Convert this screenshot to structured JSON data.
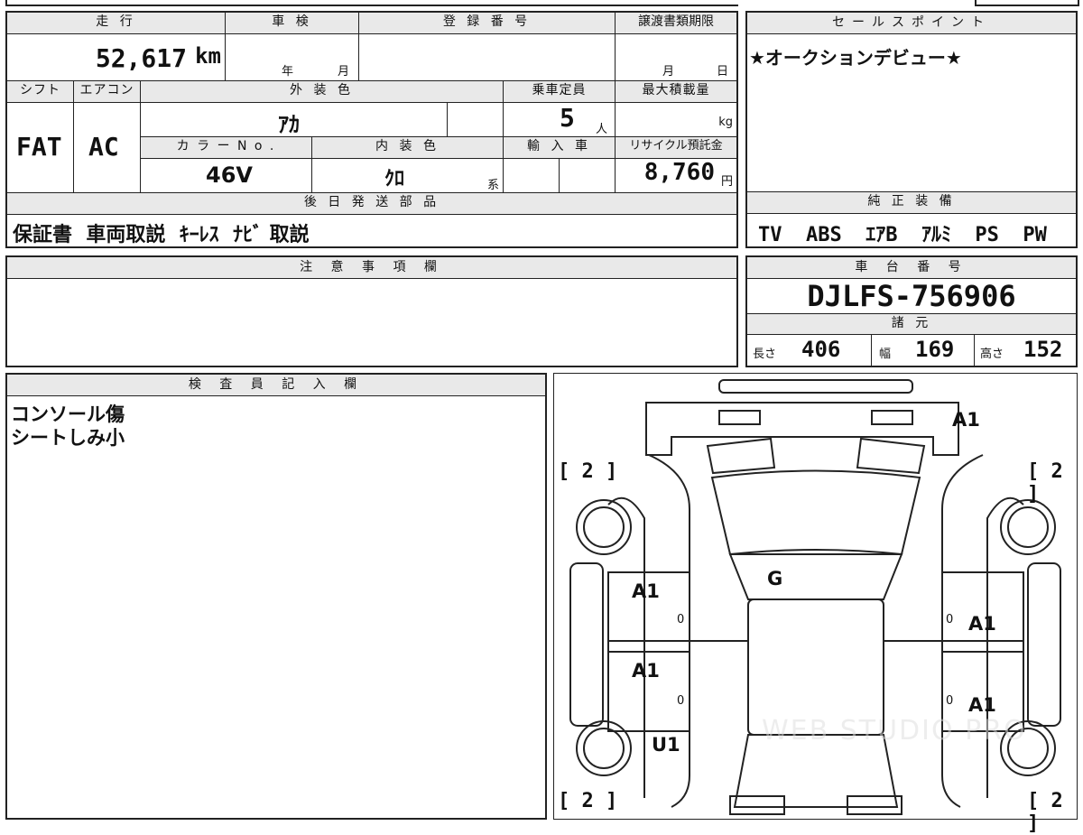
{
  "sheet": {
    "mileage_label": "走 行",
    "mileage_value": "52,617",
    "mileage_unit": "km",
    "shaken_label": "車 検",
    "shaken_year": "年",
    "shaken_month": "月",
    "reg_label": "登 録 番 号",
    "doc_deadline_label": "譲渡書類期限",
    "doc_month": "月",
    "doc_day": "日",
    "shift_label": "シフト",
    "shift_value": "FAT",
    "ac_label": "エアコン",
    "ac_value": "AC",
    "exterior_label": "外 装 色",
    "exterior_value": "ｱｶ",
    "capacity_label": "乗車定員",
    "capacity_value": "5",
    "capacity_unit": "人",
    "maxload_label": "最大積載量",
    "maxload_unit": "kg",
    "color_no_label": "カ ラ ー N o .",
    "color_no_value": "46V",
    "interior_label": "内 装 色",
    "interior_value": "ｸﾛ",
    "interior_suffix": "系",
    "import_label": "輸 入 車",
    "recycle_label": "リサイクル預託金",
    "recycle_value": "8,760",
    "recycle_unit": "円",
    "later_parts_label": "後 日 発 送 部 品",
    "later_parts_value": "保証書  車両取説  ｷｰﾚｽ  ﾅﾋﾞ 取説"
  },
  "sales": {
    "label": "セールスポイント",
    "value": "★オークションデビュー★"
  },
  "equipment": {
    "label": "純 正 装 備",
    "value": "TV  ABS  ｴｱB  ｱﾙﾐ  PS  PW"
  },
  "notes": {
    "label": "注 意 事 項 欄"
  },
  "chassis": {
    "label": "車 台 番 号",
    "value": "DJLFS-756906"
  },
  "specs": {
    "label": "諸 元",
    "length_label": "長さ",
    "length_value": "406",
    "width_label": "幅",
    "width_value": "169",
    "height_label": "高さ",
    "height_value": "152"
  },
  "inspector": {
    "label": "検 査 員 記 入 欄",
    "line1": "コンソール傷",
    "line2": "シートしみ小"
  },
  "diagram": {
    "bracket_tl": "[ 2 ]",
    "bracket_tr": "[ 2 ]",
    "bracket_bl": "[ 2 ]",
    "bracket_br": "[ 2 ]",
    "mark_front": "A1",
    "mark_glass": "G",
    "mark_lf_door": "A1",
    "mark_lr_door": "A1",
    "mark_rf_door": "A1",
    "mark_rr_door": "A1",
    "mark_lr_qtr": "U1",
    "zero_1": "0",
    "zero_2": "0",
    "zero_3": "0",
    "zero_4": "0",
    "watermark": "WEB STUDIO PRO"
  }
}
